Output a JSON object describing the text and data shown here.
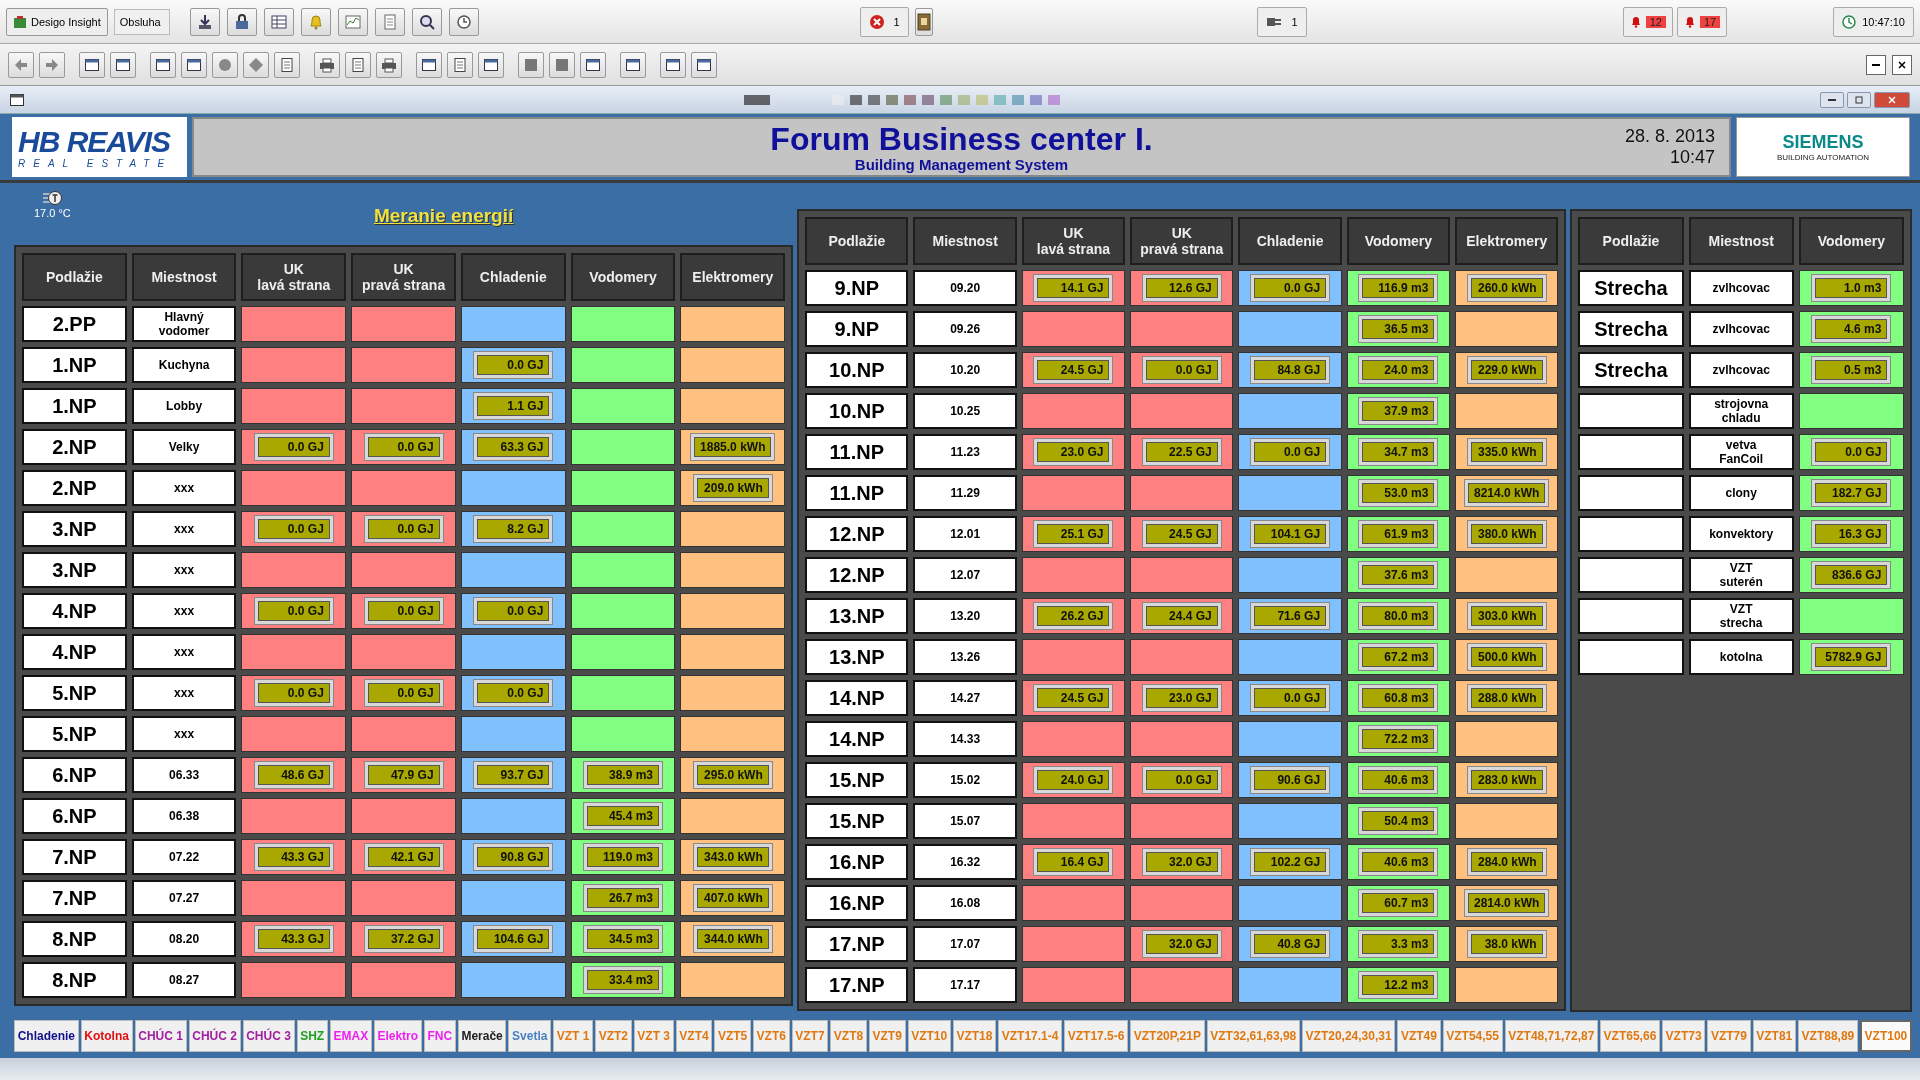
{
  "app_bar": {
    "app_button": "Desigo Insight",
    "user_field": "Obsluha",
    "error_count": "1",
    "connection_count": "1",
    "alarms": [
      {
        "count": "12"
      },
      {
        "count": "17"
      }
    ],
    "clock": "10:47:10"
  },
  "header": {
    "logo_title": "HB REAVIS",
    "logo_subtitle": "REAL ESTATE",
    "title": "Forum Business center I.",
    "subtitle": "Building Management System",
    "date": "28. 8. 2013",
    "time": "10:47",
    "brand": "SIEMENS",
    "brand_subtitle": "BUILDING AUTOMATION"
  },
  "page": {
    "temperature": "17.0 °C",
    "heading": "Meranie energií"
  },
  "tables": [
    {
      "columns": [
        {
          "label": "Podlažie",
          "kind": "floor"
        },
        {
          "label": "Miestnost",
          "kind": "room"
        },
        {
          "label": "UK\nlavá strana",
          "kind": "heat_left"
        },
        {
          "label": "UK\npravá strana",
          "kind": "heat_right"
        },
        {
          "label": "Chladenie",
          "kind": "cooling"
        },
        {
          "label": "Vodomery",
          "kind": "water"
        },
        {
          "label": "Elektromery",
          "kind": "electricity"
        }
      ],
      "rows": [
        {
          "floor": "2.PP",
          "room": "Hlavný\nvodomer"
        },
        {
          "floor": "1.NP",
          "room": "Kuchyna",
          "cooling": "0.0 GJ"
        },
        {
          "floor": "1.NP",
          "room": "Lobby",
          "cooling": "1.1 GJ"
        },
        {
          "floor": "2.NP",
          "room": "Velky",
          "heat_left": "0.0 GJ",
          "heat_right": "0.0 GJ",
          "cooling": "63.3 GJ",
          "electricity": "1885.0 kWh"
        },
        {
          "floor": "2.NP",
          "room": "xxx",
          "electricity": "209.0 kWh"
        },
        {
          "floor": "3.NP",
          "room": "xxx",
          "heat_left": "0.0 GJ",
          "heat_right": "0.0 GJ",
          "cooling": "8.2 GJ"
        },
        {
          "floor": "3.NP",
          "room": "xxx"
        },
        {
          "floor": "4.NP",
          "room": "xxx",
          "heat_left": "0.0 GJ",
          "heat_right": "0.0 GJ",
          "cooling": "0.0 GJ"
        },
        {
          "floor": "4.NP",
          "room": "xxx"
        },
        {
          "floor": "5.NP",
          "room": "xxx",
          "heat_left": "0.0 GJ",
          "heat_right": "0.0 GJ",
          "cooling": "0.0 GJ"
        },
        {
          "floor": "5.NP",
          "room": "xxx"
        },
        {
          "floor": "6.NP",
          "room": "06.33",
          "heat_left": "48.6 GJ",
          "heat_right": "47.9 GJ",
          "cooling": "93.7 GJ",
          "water": "38.9 m3",
          "electricity": "295.0 kWh"
        },
        {
          "floor": "6.NP",
          "room": "06.38",
          "water": "45.4 m3"
        },
        {
          "floor": "7.NP",
          "room": "07.22",
          "heat_left": "43.3 GJ",
          "heat_right": "42.1 GJ",
          "cooling": "90.8 GJ",
          "water": "119.0 m3",
          "electricity": "343.0 kWh"
        },
        {
          "floor": "7.NP",
          "room": "07.27",
          "water": "26.7 m3",
          "electricity": "407.0 kWh"
        },
        {
          "floor": "8.NP",
          "room": "08.20",
          "heat_left": "43.3 GJ",
          "heat_right": "37.2 GJ",
          "cooling": "104.6 GJ",
          "water": "34.5 m3",
          "electricity": "344.0 kWh"
        },
        {
          "floor": "8.NP",
          "room": "08.27",
          "water": "33.4 m3"
        }
      ]
    },
    {
      "columns": [
        {
          "label": "Podlažie",
          "kind": "floor"
        },
        {
          "label": "Miestnost",
          "kind": "room"
        },
        {
          "label": "UK\nlavá strana",
          "kind": "heat_left"
        },
        {
          "label": "UK\npravá strana",
          "kind": "heat_right"
        },
        {
          "label": "Chladenie",
          "kind": "cooling"
        },
        {
          "label": "Vodomery",
          "kind": "water"
        },
        {
          "label": "Elektromery",
          "kind": "electricity"
        }
      ],
      "rows": [
        {
          "floor": "9.NP",
          "room": "09.20",
          "heat_left": "14.1 GJ",
          "heat_right": "12.6 GJ",
          "cooling": "0.0 GJ",
          "water": "116.9 m3",
          "electricity": "260.0 kWh"
        },
        {
          "floor": "9.NP",
          "room": "09.26",
          "water": "36.5 m3"
        },
        {
          "floor": "10.NP",
          "room": "10.20",
          "heat_left": "24.5 GJ",
          "heat_right": "0.0 GJ",
          "cooling": "84.8 GJ",
          "water": "24.0 m3",
          "electricity": "229.0 kWh"
        },
        {
          "floor": "10.NP",
          "room": "10.25",
          "water": "37.9 m3"
        },
        {
          "floor": "11.NP",
          "room": "11.23",
          "heat_left": "23.0 GJ",
          "heat_right": "22.5 GJ",
          "cooling": "0.0 GJ",
          "water": "34.7 m3",
          "electricity": "335.0 kWh"
        },
        {
          "floor": "11.NP",
          "room": "11.29",
          "water": "53.0 m3",
          "electricity": "8214.0 kWh"
        },
        {
          "floor": "12.NP",
          "room": "12.01",
          "heat_left": "25.1 GJ",
          "heat_right": "24.5 GJ",
          "cooling": "104.1 GJ",
          "water": "61.9 m3",
          "electricity": "380.0 kWh"
        },
        {
          "floor": "12.NP",
          "room": "12.07",
          "water": "37.6 m3"
        },
        {
          "floor": "13.NP",
          "room": "13.20",
          "heat_left": "26.2 GJ",
          "heat_right": "24.4 GJ",
          "cooling": "71.6 GJ",
          "water": "80.0 m3",
          "electricity": "303.0 kWh"
        },
        {
          "floor": "13.NP",
          "room": "13.26",
          "water": "67.2 m3",
          "electricity": "500.0 kWh"
        },
        {
          "floor": "14.NP",
          "room": "14.27",
          "heat_left": "24.5 GJ",
          "heat_right": "23.0 GJ",
          "cooling": "0.0 GJ",
          "water": "60.8 m3",
          "electricity": "288.0 kWh"
        },
        {
          "floor": "14.NP",
          "room": "14.33",
          "water": "72.2 m3"
        },
        {
          "floor": "15.NP",
          "room": "15.02",
          "heat_left": "24.0 GJ",
          "heat_right": "0.0 GJ",
          "cooling": "90.6 GJ",
          "water": "40.6 m3",
          "electricity": "283.0 kWh"
        },
        {
          "floor": "15.NP",
          "room": "15.07",
          "water": "50.4 m3"
        },
        {
          "floor": "16.NP",
          "room": "16.32",
          "heat_left": "16.4 GJ",
          "heat_right": "32.0 GJ",
          "cooling": "102.2 GJ",
          "water": "40.6 m3",
          "electricity": "284.0 kWh"
        },
        {
          "floor": "16.NP",
          "room": "16.08",
          "water": "60.7 m3",
          "electricity": "2814.0 kWh"
        },
        {
          "floor": "17.NP",
          "room": "17.07",
          "heat_right": "32.0 GJ",
          "cooling": "40.8 GJ",
          "water": "3.3 m3",
          "electricity": "38.0 kWh"
        },
        {
          "floor": "17.NP",
          "room": "17.17",
          "water": "12.2 m3"
        }
      ]
    },
    {
      "columns": [
        {
          "label": "Podlažie",
          "kind": "floor"
        },
        {
          "label": "Miestnost",
          "kind": "room"
        },
        {
          "label": "Vodomery",
          "kind": "water"
        }
      ],
      "rows": [
        {
          "floor": "Strecha",
          "room": "zvlhcovac",
          "water": "1.0 m3"
        },
        {
          "floor": "Strecha",
          "room": "zvlhcovac",
          "water": "4.6 m3"
        },
        {
          "floor": "Strecha",
          "room": "zvlhcovac",
          "water": "0.5 m3"
        },
        {
          "room": "strojovna\nchladu"
        },
        {
          "room": "vetva\nFanCoil",
          "water": "0.0 GJ"
        },
        {
          "room": "clony",
          "water": "182.7 GJ"
        },
        {
          "room": "konvektory",
          "water": "16.3 GJ"
        },
        {
          "room": "VZT\nsuterén",
          "water": "836.6 GJ"
        },
        {
          "room": "VZT\nstrecha"
        },
        {
          "room": "kotolna",
          "water": "5782.9 GJ"
        }
      ]
    }
  ],
  "tabs": [
    {
      "label": "Chladenie",
      "color": "#10108c",
      "selected": false
    },
    {
      "label": "Kotolna",
      "color": "#e01010",
      "selected": false
    },
    {
      "label": "CHÚC 1",
      "color": "#a020a0",
      "selected": false
    },
    {
      "label": "CHÚC 2",
      "color": "#a020a0",
      "selected": false
    },
    {
      "label": "CHÚC 3",
      "color": "#a020a0",
      "selected": false
    },
    {
      "label": "SHZ",
      "color": "#20a020",
      "selected": false
    },
    {
      "label": "EMAX",
      "color": "#f020f0",
      "selected": false
    },
    {
      "label": "Elektro",
      "color": "#f020f0",
      "selected": false
    },
    {
      "label": "FNC",
      "color": "#f020f0",
      "selected": false
    },
    {
      "label": "Merače",
      "color": "#202020",
      "selected": false
    },
    {
      "label": "Svetla",
      "color": "#4a80c0",
      "selected": false
    },
    {
      "label": "VZT 1",
      "color": "#e07810",
      "selected": false
    },
    {
      "label": "VZT2",
      "color": "#e07810",
      "selected": false
    },
    {
      "label": "VZT 3",
      "color": "#e07810",
      "selected": false
    },
    {
      "label": "VZT4",
      "color": "#e07810",
      "selected": false
    },
    {
      "label": "VZT5",
      "color": "#e07810",
      "selected": false
    },
    {
      "label": "VZT6",
      "color": "#e07810",
      "selected": false
    },
    {
      "label": "VZT7",
      "color": "#e07810",
      "selected": false
    },
    {
      "label": "VZT8",
      "color": "#e07810",
      "selected": false
    },
    {
      "label": "VZT9",
      "color": "#e07810",
      "selected": false
    },
    {
      "label": "VZT10",
      "color": "#e07810",
      "selected": false
    },
    {
      "label": "VZT18",
      "color": "#e07810",
      "selected": false
    },
    {
      "label": "VZT17.1-4",
      "color": "#e07810",
      "selected": false
    },
    {
      "label": "VZT17.5-6",
      "color": "#e07810",
      "selected": false
    },
    {
      "label": "VZT20P,21P",
      "color": "#e07810",
      "selected": false
    },
    {
      "label": "VZT32,61,63,98",
      "color": "#e07810",
      "selected": false
    },
    {
      "label": "VZT20,24,30,31",
      "color": "#e07810",
      "selected": false
    },
    {
      "label": "VZT49",
      "color": "#e07810",
      "selected": false
    },
    {
      "label": "VZT54,55",
      "color": "#e07810",
      "selected": false
    },
    {
      "label": "VZT48,71,72,87",
      "color": "#e07810",
      "selected": false
    },
    {
      "label": "VZT65,66",
      "color": "#e07810",
      "selected": false
    },
    {
      "label": "VZT73",
      "color": "#e07810",
      "selected": false
    },
    {
      "label": "VZT79",
      "color": "#e07810",
      "selected": false
    },
    {
      "label": "VZT81",
      "color": "#e07810",
      "selected": false
    },
    {
      "label": "VZT88,89",
      "color": "#e07810",
      "selected": false
    },
    {
      "label": "VZT100",
      "color": "#e07810",
      "selected": true
    }
  ]
}
